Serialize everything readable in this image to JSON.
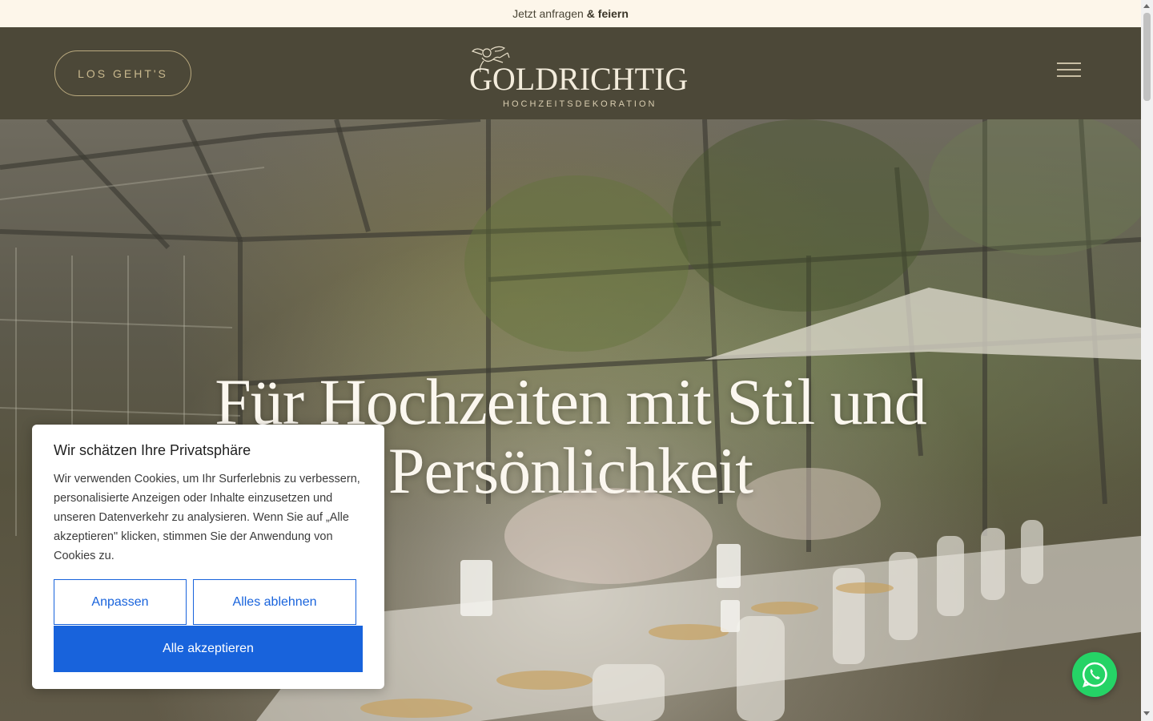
{
  "announcement": {
    "text": "Jetzt anfragen",
    "strong": "& feiern"
  },
  "header": {
    "cta_label": "LOS GEHT'S",
    "logo_name": "GOLDRICHTIG",
    "logo_sub": "HOCHZEITSDEKORATION",
    "menu_icon": "hamburger-menu-icon"
  },
  "hero": {
    "title": "Für Hochzeiten mit Stil und Persönlichkeit"
  },
  "cookie": {
    "title": "Wir schätzen Ihre Privatsphäre",
    "text": "Wir verwenden Cookies, um Ihr Surferlebnis zu verbessern, personalisierte Anzeigen oder Inhalte einzusetzen und unseren Datenverkehr zu analysieren. Wenn Sie auf „Alle akzeptieren\" klicken, stimmen Sie der Anwendung von Cookies zu.",
    "customize_label": "Anpassen",
    "reject_label": "Alles ablehnen",
    "accept_label": "Alle akzeptieren"
  },
  "colors": {
    "header_bg": "#4c4838",
    "announce_bg": "#fdf6ea",
    "accent_gold": "#c9b98e",
    "cookie_blue": "#1863dc",
    "whatsapp_green": "#25d366"
  },
  "whatsapp": {
    "icon": "whatsapp-icon"
  }
}
